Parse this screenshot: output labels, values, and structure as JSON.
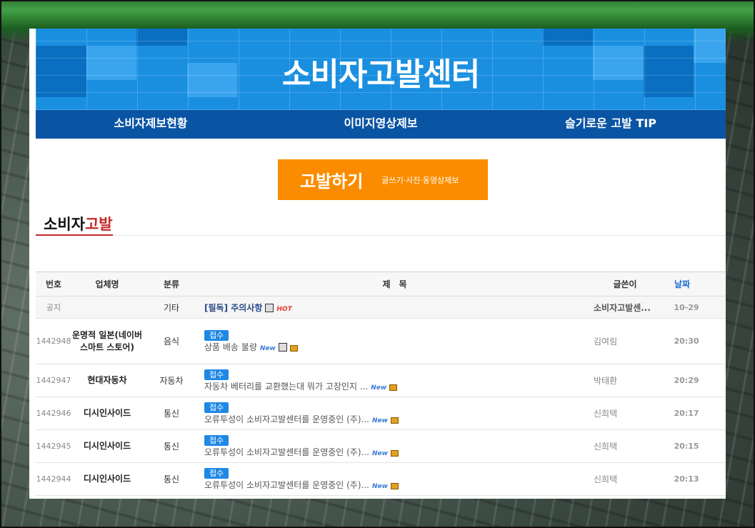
{
  "banner": {
    "title": "소비자고발센터"
  },
  "nav": {
    "items": [
      "소비자제보현황",
      "이미지영상제보",
      "슬기로운 고발 TIP"
    ]
  },
  "report_button": {
    "label": "고발하기",
    "sub": "글쓰기·사진·동영상제보"
  },
  "section": {
    "title_a": "소비자",
    "title_b": "고발"
  },
  "table": {
    "headers": {
      "no": "번호",
      "company": "업체명",
      "category": "분류",
      "subject": "제　목",
      "writer": "글쓴이",
      "date": "날짜"
    },
    "notice": {
      "no": "공지",
      "company": "",
      "category": "기타",
      "subject": "[필독] 주의사항",
      "writer": "소비자고발센...",
      "date": "10-29",
      "badge": "HOT"
    },
    "rows": [
      {
        "no": "1442948",
        "company": "운명적 일본(네이버 스마트 스토어)",
        "category": "음식",
        "status": "접수",
        "subject": "상품 배송 불량",
        "writer": "김여림",
        "date": "20:30"
      },
      {
        "no": "1442947",
        "company": "현대자동차",
        "category": "자동차",
        "status": "접수",
        "subject": "자동차 베터리를 교환했는대 뭐가 고장인지 ...",
        "writer": "박태환",
        "date": "20:29"
      },
      {
        "no": "1442946",
        "company": "디시인사이드",
        "category": "통신",
        "status": "접수",
        "subject": "오류투성이 소비자고발센터를 운영중인 (주)...",
        "writer": "신희택",
        "date": "20:17"
      },
      {
        "no": "1442945",
        "company": "디시인사이드",
        "category": "통신",
        "status": "접수",
        "subject": "오류투성이 소비자고발센터를 운영중인 (주)...",
        "writer": "신희택",
        "date": "20:15"
      },
      {
        "no": "1442944",
        "company": "디시인사이드",
        "category": "통신",
        "status": "접수",
        "subject": "오류투성이 소비자고발센터를 운영중인 (주)...",
        "writer": "신희택",
        "date": "20:13"
      }
    ],
    "new_badge": "New"
  },
  "colors": {
    "banner": "#1a8fe0",
    "nav": "#0a54a4",
    "report": "#fb8c00",
    "accent_red": "#c62828",
    "status": "#1e88e5"
  }
}
